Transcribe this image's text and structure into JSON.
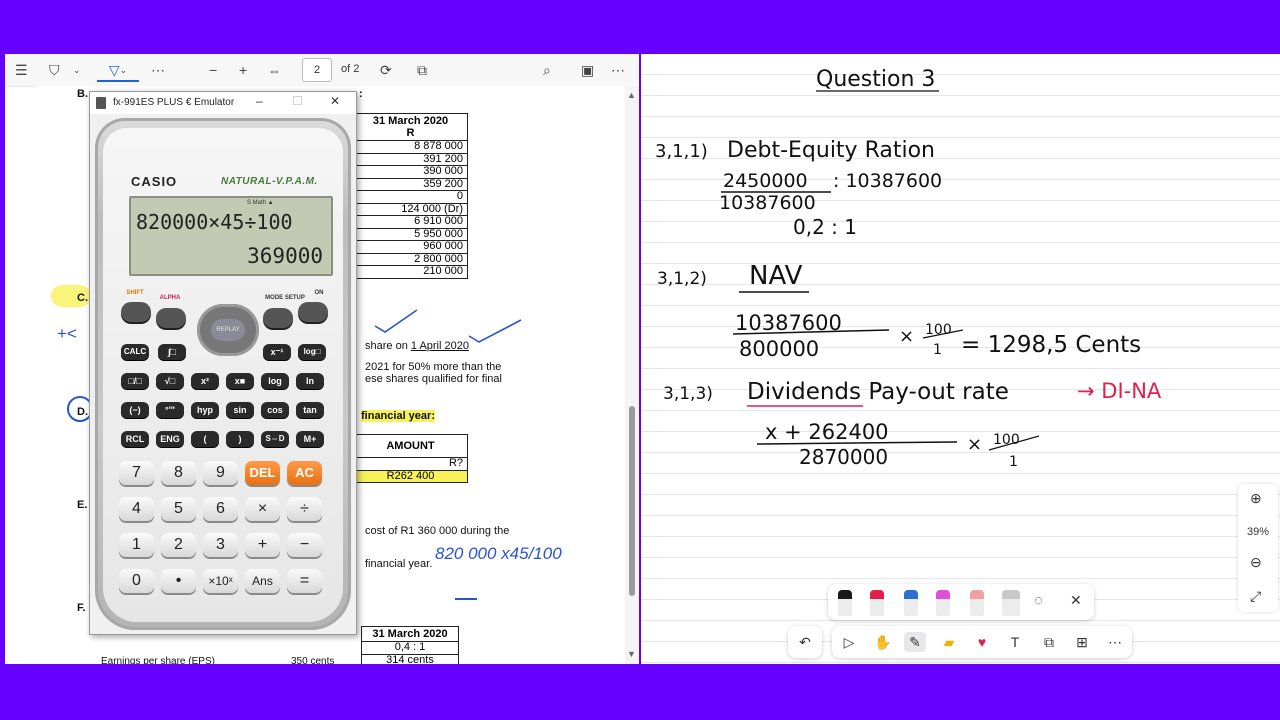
{
  "pdf_viewer": {
    "toolbar": {
      "menu_icon": "list-icon",
      "highlight_icon": "highlighter-icon",
      "draw_icon": "pen-icon",
      "more": "⋯",
      "zoom_out": "−",
      "zoom_in": "+",
      "page": "2",
      "page_of": "of 2"
    },
    "document": {
      "left_letters": [
        "B.",
        "C.",
        "D.",
        "E.",
        "F."
      ],
      "table1": {
        "header_date": "31 March 2020",
        "header_unit": "R",
        "values": [
          "8 878 000",
          "391 200",
          "390 000",
          "359 200",
          "0",
          "124 000 (Dr)",
          "6 910 000",
          "5 950 000",
          "960 000",
          "2 800 000",
          "210 000"
        ]
      },
      "header_fragment": ":",
      "share_text": "share on",
      "share_date": "1 April 2020",
      "line_2021_a": "2021 for 50% more than the",
      "line_2021_b": "ese shares qualified for final",
      "financial_year": "financial year",
      "table2": {
        "header": "AMOUNT",
        "row1": "R?",
        "row2": "R262 400"
      },
      "cost_line": "cost of R1 360 000 during the",
      "fin_year_line": "financial year.",
      "table3": {
        "header": "31 March 2020",
        "row1": "0,4 : 1",
        "row2": "314 cents"
      },
      "eps_line": "Earnings per share (EPS)",
      "eps_value": "350 cents",
      "annotation_calc": "820 000 x45/100",
      "annotation_plus": "+<"
    }
  },
  "calculator": {
    "window_title": "fx-991ES PLUS € Emulator",
    "brand": "CASIO",
    "tagline": "NATURAL-V.P.A.M.",
    "display": {
      "indicators": "S    Math ▲",
      "input": "820000×45÷100",
      "result": "369000"
    },
    "top_labels": [
      "SHIFT",
      "ALPHA",
      "MODE SETUP",
      "ON"
    ],
    "replay": "REPLAY",
    "row_keys": [
      [
        "CALC",
        "∫□",
        "x⁻¹",
        "log□"
      ],
      [
        "□/□",
        "√□",
        "x²",
        "x■",
        "log",
        "ln"
      ],
      [
        "(−)",
        "°'\"",
        "hyp",
        "sin",
        "cos",
        "tan"
      ],
      [
        "RCL",
        "ENG",
        "(",
        ")",
        "S⇔D",
        "M+"
      ]
    ],
    "num_keys": [
      [
        "7",
        "8",
        "9",
        "DEL",
        "AC"
      ],
      [
        "4",
        "5",
        "6",
        "×",
        "÷"
      ],
      [
        "1",
        "2",
        "3",
        "+",
        "−"
      ],
      [
        "0",
        "•",
        "×10ˣ",
        "Ans",
        "="
      ]
    ]
  },
  "whiteboard": {
    "title": "Question 3",
    "q1_label": "3,1,1)",
    "q1_heading": "Debt-Equity Ration",
    "q1_fraction_num": "2450000",
    "q1_colon_rhs": ": 10387600",
    "q1_fraction_den": "10387600",
    "q1_answer": "0,2 : 1",
    "q2_label": "3,1,2)",
    "q2_heading": "NAV",
    "q2_num": "10387600",
    "q2_den": "800000",
    "q2_mult": "×",
    "q2_pct_num": "100",
    "q2_pct_den": "1",
    "q2_result": "= 1298,5 Cents",
    "q3_label": "3,1,3)",
    "q3_heading": "Dividends Pay-out rate",
    "q3_arrow": "→ DI-NA",
    "q3_num": "x + 262400",
    "q3_den": "2870000",
    "q3_mult": "×",
    "q3_pct_num": "100",
    "q3_pct_den": "1",
    "accent_red": "#e0204a",
    "accent_blue": "#1a4fd6"
  },
  "zoom": {
    "value": "39%"
  },
  "ink_toolbar": {
    "pens": [
      "#1a1a1a",
      "#e0204a",
      "#2b6fd6",
      "#e04fd6",
      "#f0a0a0",
      "#c8c8c8"
    ]
  }
}
